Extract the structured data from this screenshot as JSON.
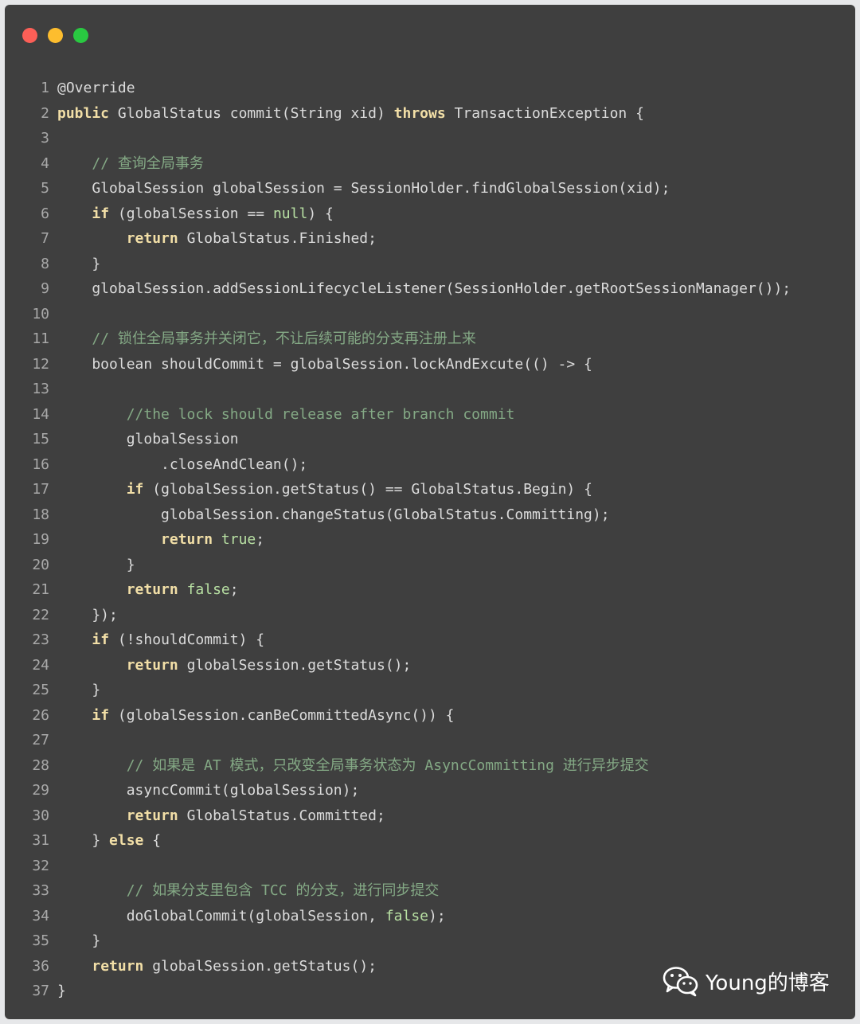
{
  "window": {
    "controls": [
      "close",
      "minimize",
      "maximize"
    ],
    "colors": {
      "background": "#3f3f3f",
      "close": "#fc5f57",
      "minimize": "#fdbd2e",
      "maximize": "#29c941"
    }
  },
  "code": {
    "language": "java",
    "lines": [
      {
        "n": "1",
        "tokens": [
          [
            "",
            "@Override"
          ]
        ]
      },
      {
        "n": "2",
        "tokens": [
          [
            "kw",
            "public"
          ],
          [
            "",
            " GlobalStatus commit(String xid) "
          ],
          [
            "kw",
            "throws"
          ],
          [
            "",
            " TransactionException {"
          ]
        ]
      },
      {
        "n": "3",
        "tokens": []
      },
      {
        "n": "4",
        "tokens": [
          [
            "",
            "    "
          ],
          [
            "cm",
            "// 查询全局事务"
          ]
        ]
      },
      {
        "n": "5",
        "tokens": [
          [
            "",
            "    GlobalSession globalSession = SessionHolder.findGlobalSession(xid);"
          ]
        ]
      },
      {
        "n": "6",
        "tokens": [
          [
            "",
            "    "
          ],
          [
            "kw",
            "if"
          ],
          [
            "",
            " (globalSession == "
          ],
          [
            "lit",
            "null"
          ],
          [
            "",
            ") {"
          ]
        ]
      },
      {
        "n": "7",
        "tokens": [
          [
            "",
            "        "
          ],
          [
            "kw",
            "return"
          ],
          [
            "",
            " GlobalStatus.Finished;"
          ]
        ]
      },
      {
        "n": "8",
        "tokens": [
          [
            "",
            "    }"
          ]
        ]
      },
      {
        "n": "9",
        "tokens": [
          [
            "",
            "    globalSession.addSessionLifecycleListener(SessionHolder.getRootSessionManager());"
          ]
        ]
      },
      {
        "n": "10",
        "tokens": []
      },
      {
        "n": "11",
        "tokens": [
          [
            "",
            "    "
          ],
          [
            "cm",
            "// 锁住全局事务并关闭它，不让后续可能的分支再注册上来"
          ]
        ]
      },
      {
        "n": "12",
        "tokens": [
          [
            "",
            "    boolean shouldCommit = globalSession.lockAndExcute(() -> {"
          ]
        ]
      },
      {
        "n": "13",
        "tokens": []
      },
      {
        "n": "14",
        "tokens": [
          [
            "",
            "        "
          ],
          [
            "cm",
            "//the lock should release after branch commit"
          ]
        ]
      },
      {
        "n": "15",
        "tokens": [
          [
            "",
            "        globalSession"
          ]
        ]
      },
      {
        "n": "16",
        "tokens": [
          [
            "",
            "            .closeAndClean();"
          ]
        ]
      },
      {
        "n": "17",
        "tokens": [
          [
            "",
            "        "
          ],
          [
            "kw",
            "if"
          ],
          [
            "",
            " (globalSession.getStatus() == GlobalStatus.Begin) {"
          ]
        ]
      },
      {
        "n": "18",
        "tokens": [
          [
            "",
            "            globalSession.changeStatus(GlobalStatus.Committing);"
          ]
        ]
      },
      {
        "n": "19",
        "tokens": [
          [
            "",
            "            "
          ],
          [
            "kw",
            "return"
          ],
          [
            "",
            " "
          ],
          [
            "lit",
            "true"
          ],
          [
            "",
            ";"
          ]
        ]
      },
      {
        "n": "20",
        "tokens": [
          [
            "",
            "        }"
          ]
        ]
      },
      {
        "n": "21",
        "tokens": [
          [
            "",
            "        "
          ],
          [
            "kw",
            "return"
          ],
          [
            "",
            " "
          ],
          [
            "lit",
            "false"
          ],
          [
            "",
            ";"
          ]
        ]
      },
      {
        "n": "22",
        "tokens": [
          [
            "",
            "    });"
          ]
        ]
      },
      {
        "n": "23",
        "tokens": [
          [
            "",
            "    "
          ],
          [
            "kw",
            "if"
          ],
          [
            "",
            " (!shouldCommit) {"
          ]
        ]
      },
      {
        "n": "24",
        "tokens": [
          [
            "",
            "        "
          ],
          [
            "kw",
            "return"
          ],
          [
            "",
            " globalSession.getStatus();"
          ]
        ]
      },
      {
        "n": "25",
        "tokens": [
          [
            "",
            "    }"
          ]
        ]
      },
      {
        "n": "26",
        "tokens": [
          [
            "",
            "    "
          ],
          [
            "kw",
            "if"
          ],
          [
            "",
            " (globalSession.canBeCommittedAsync()) {"
          ]
        ]
      },
      {
        "n": "27",
        "tokens": []
      },
      {
        "n": "28",
        "tokens": [
          [
            "",
            "        "
          ],
          [
            "cm",
            "// 如果是 AT 模式，只改变全局事务状态为 AsyncCommitting 进行异步提交"
          ]
        ]
      },
      {
        "n": "29",
        "tokens": [
          [
            "",
            "        asyncCommit(globalSession);"
          ]
        ]
      },
      {
        "n": "30",
        "tokens": [
          [
            "",
            "        "
          ],
          [
            "kw",
            "return"
          ],
          [
            "",
            " GlobalStatus.Committed;"
          ]
        ]
      },
      {
        "n": "31",
        "tokens": [
          [
            "",
            "    } "
          ],
          [
            "kw",
            "else"
          ],
          [
            "",
            " {"
          ]
        ]
      },
      {
        "n": "32",
        "tokens": []
      },
      {
        "n": "33",
        "tokens": [
          [
            "",
            "        "
          ],
          [
            "cm",
            "// 如果分支里包含 TCC 的分支，进行同步提交"
          ]
        ]
      },
      {
        "n": "34",
        "tokens": [
          [
            "",
            "        doGlobalCommit(globalSession, "
          ],
          [
            "lit",
            "false"
          ],
          [
            "",
            ");"
          ]
        ]
      },
      {
        "n": "35",
        "tokens": [
          [
            "",
            "    }"
          ]
        ]
      },
      {
        "n": "36",
        "tokens": [
          [
            "",
            "    "
          ],
          [
            "kw",
            "return"
          ],
          [
            "",
            " globalSession.getStatus();"
          ]
        ]
      },
      {
        "n": "37",
        "tokens": [
          [
            "",
            "}"
          ]
        ]
      }
    ]
  },
  "watermark": {
    "icon": "wechat-icon",
    "text": "Young的博客"
  }
}
